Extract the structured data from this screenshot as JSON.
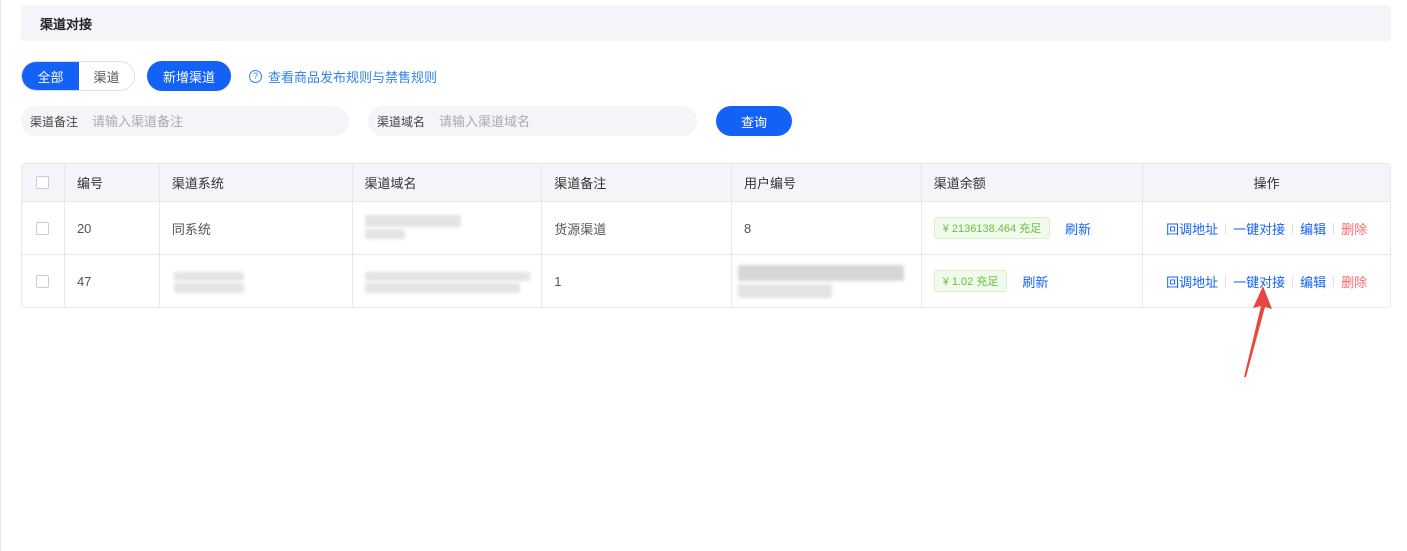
{
  "header": {
    "title": "渠道对接"
  },
  "toolbar": {
    "filter_all": "全部",
    "filter_channel": "渠道",
    "add_channel": "新增渠道",
    "help_link": "查看商品发布规则与禁售规则",
    "help_icon": "?"
  },
  "search": {
    "remark_label": "渠道备注",
    "remark_placeholder": "请输入渠道备注",
    "domain_label": "渠道域名",
    "domain_placeholder": "请输入渠道域名",
    "query_button": "查询"
  },
  "table": {
    "columns": [
      "编号",
      "渠道系统",
      "渠道域名",
      "渠道备注",
      "用户编号",
      "渠道余额",
      "操作"
    ],
    "rows": [
      {
        "id": "20",
        "system": "同系统",
        "domain": "",
        "remark": "货源渠道",
        "user_id": "8",
        "balance": "¥ 2136138.464 充足",
        "refresh": "刷新",
        "ops": [
          "回调地址",
          "一键对接",
          "编辑",
          "删除"
        ]
      },
      {
        "id": "47",
        "system": "",
        "domain": "",
        "remark": "1",
        "user_id": "",
        "balance": "¥ 1.02 充足",
        "refresh": "刷新",
        "ops": [
          "回调地址",
          "一键对接",
          "编辑",
          "删除"
        ]
      }
    ]
  },
  "colors": {
    "primary": "#1462f5",
    "link": "#2f84e8",
    "danger": "#f56c6c",
    "success": "#67c23a",
    "annotation": "#e8473f"
  }
}
